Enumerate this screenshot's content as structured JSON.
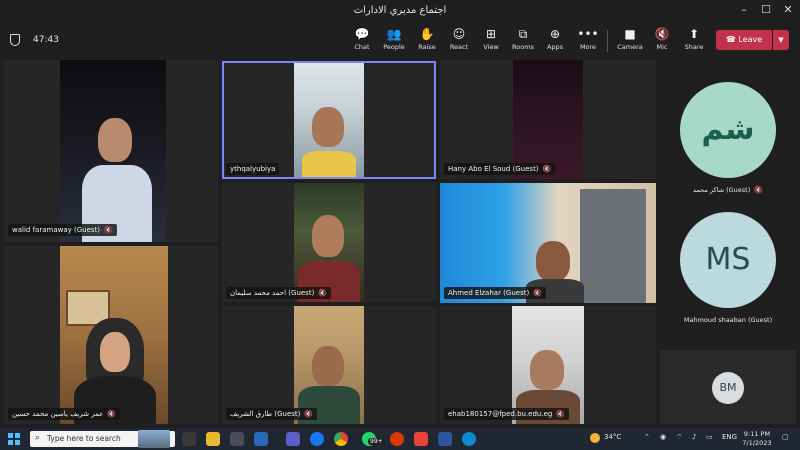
{
  "window": {
    "title": "اجتماع مديري الادارات"
  },
  "toolbar": {
    "timer": "47:43",
    "buttons": [
      {
        "label": "Chat",
        "icon": "chat-icon"
      },
      {
        "label": "People",
        "icon": "people-icon"
      },
      {
        "label": "Raise",
        "icon": "raise-hand-icon"
      },
      {
        "label": "React",
        "icon": "react-icon"
      },
      {
        "label": "View",
        "icon": "view-icon"
      },
      {
        "label": "Rooms",
        "icon": "rooms-icon"
      },
      {
        "label": "Apps",
        "icon": "apps-icon"
      },
      {
        "label": "More",
        "icon": "more-icon"
      },
      {
        "label": "Camera",
        "icon": "camera-off-icon"
      },
      {
        "label": "Mic",
        "icon": "mic-muted-icon"
      },
      {
        "label": "Share",
        "icon": "share-icon"
      }
    ],
    "leave_label": "Leave",
    "leave_color": "#c4314b"
  },
  "participants": [
    {
      "name": "walid faramaway (Guest)"
    },
    {
      "name": "ythqalyubiya",
      "active_speaker": true
    },
    {
      "name": "Hany Abo El Soud (Guest)"
    },
    {
      "name": "احمد محمد سليمان (Guest)"
    },
    {
      "name": "Ahmed Elzahar (Guest)"
    },
    {
      "name": "عمر شريف ياسين محمد حسين"
    },
    {
      "name": "طارق الشريف (Guest)"
    },
    {
      "name": "ehab180157@fped.bu.edu.eg"
    }
  ],
  "side_panel": [
    {
      "initials": "شم",
      "name": "شاكر محمد (Guest)",
      "bg": "#a8d8c8",
      "fg": "#1d5f4f"
    },
    {
      "initials": "MS",
      "name": "Mahmoud shaaban (Guest)",
      "bg": "#bcd9de",
      "fg": "#2d4a50"
    },
    {
      "initials": "BM",
      "bg": "#d8dde2",
      "fg": "#3a4048"
    }
  ],
  "taskbar": {
    "search_placeholder": "Type here to search",
    "badge": "99+",
    "weather": "34°C",
    "language": "ENG",
    "time": "9:11 PM",
    "date": "7/1/2023"
  }
}
